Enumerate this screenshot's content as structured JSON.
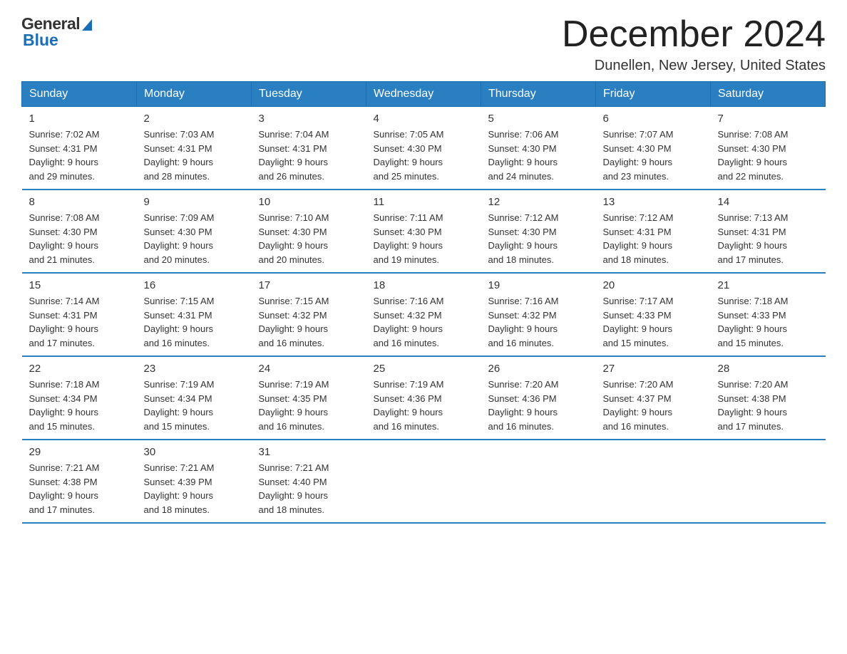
{
  "logo": {
    "general": "General",
    "blue": "Blue"
  },
  "title": "December 2024",
  "location": "Dunellen, New Jersey, United States",
  "days_of_week": [
    "Sunday",
    "Monday",
    "Tuesday",
    "Wednesday",
    "Thursday",
    "Friday",
    "Saturday"
  ],
  "weeks": [
    [
      {
        "day": "1",
        "sunrise": "7:02 AM",
        "sunset": "4:31 PM",
        "daylight": "9 hours and 29 minutes."
      },
      {
        "day": "2",
        "sunrise": "7:03 AM",
        "sunset": "4:31 PM",
        "daylight": "9 hours and 28 minutes."
      },
      {
        "day": "3",
        "sunrise": "7:04 AM",
        "sunset": "4:31 PM",
        "daylight": "9 hours and 26 minutes."
      },
      {
        "day": "4",
        "sunrise": "7:05 AM",
        "sunset": "4:30 PM",
        "daylight": "9 hours and 25 minutes."
      },
      {
        "day": "5",
        "sunrise": "7:06 AM",
        "sunset": "4:30 PM",
        "daylight": "9 hours and 24 minutes."
      },
      {
        "day": "6",
        "sunrise": "7:07 AM",
        "sunset": "4:30 PM",
        "daylight": "9 hours and 23 minutes."
      },
      {
        "day": "7",
        "sunrise": "7:08 AM",
        "sunset": "4:30 PM",
        "daylight": "9 hours and 22 minutes."
      }
    ],
    [
      {
        "day": "8",
        "sunrise": "7:08 AM",
        "sunset": "4:30 PM",
        "daylight": "9 hours and 21 minutes."
      },
      {
        "day": "9",
        "sunrise": "7:09 AM",
        "sunset": "4:30 PM",
        "daylight": "9 hours and 20 minutes."
      },
      {
        "day": "10",
        "sunrise": "7:10 AM",
        "sunset": "4:30 PM",
        "daylight": "9 hours and 20 minutes."
      },
      {
        "day": "11",
        "sunrise": "7:11 AM",
        "sunset": "4:30 PM",
        "daylight": "9 hours and 19 minutes."
      },
      {
        "day": "12",
        "sunrise": "7:12 AM",
        "sunset": "4:30 PM",
        "daylight": "9 hours and 18 minutes."
      },
      {
        "day": "13",
        "sunrise": "7:12 AM",
        "sunset": "4:31 PM",
        "daylight": "9 hours and 18 minutes."
      },
      {
        "day": "14",
        "sunrise": "7:13 AM",
        "sunset": "4:31 PM",
        "daylight": "9 hours and 17 minutes."
      }
    ],
    [
      {
        "day": "15",
        "sunrise": "7:14 AM",
        "sunset": "4:31 PM",
        "daylight": "9 hours and 17 minutes."
      },
      {
        "day": "16",
        "sunrise": "7:15 AM",
        "sunset": "4:31 PM",
        "daylight": "9 hours and 16 minutes."
      },
      {
        "day": "17",
        "sunrise": "7:15 AM",
        "sunset": "4:32 PM",
        "daylight": "9 hours and 16 minutes."
      },
      {
        "day": "18",
        "sunrise": "7:16 AM",
        "sunset": "4:32 PM",
        "daylight": "9 hours and 16 minutes."
      },
      {
        "day": "19",
        "sunrise": "7:16 AM",
        "sunset": "4:32 PM",
        "daylight": "9 hours and 16 minutes."
      },
      {
        "day": "20",
        "sunrise": "7:17 AM",
        "sunset": "4:33 PM",
        "daylight": "9 hours and 15 minutes."
      },
      {
        "day": "21",
        "sunrise": "7:18 AM",
        "sunset": "4:33 PM",
        "daylight": "9 hours and 15 minutes."
      }
    ],
    [
      {
        "day": "22",
        "sunrise": "7:18 AM",
        "sunset": "4:34 PM",
        "daylight": "9 hours and 15 minutes."
      },
      {
        "day": "23",
        "sunrise": "7:19 AM",
        "sunset": "4:34 PM",
        "daylight": "9 hours and 15 minutes."
      },
      {
        "day": "24",
        "sunrise": "7:19 AM",
        "sunset": "4:35 PM",
        "daylight": "9 hours and 16 minutes."
      },
      {
        "day": "25",
        "sunrise": "7:19 AM",
        "sunset": "4:36 PM",
        "daylight": "9 hours and 16 minutes."
      },
      {
        "day": "26",
        "sunrise": "7:20 AM",
        "sunset": "4:36 PM",
        "daylight": "9 hours and 16 minutes."
      },
      {
        "day": "27",
        "sunrise": "7:20 AM",
        "sunset": "4:37 PM",
        "daylight": "9 hours and 16 minutes."
      },
      {
        "day": "28",
        "sunrise": "7:20 AM",
        "sunset": "4:38 PM",
        "daylight": "9 hours and 17 minutes."
      }
    ],
    [
      {
        "day": "29",
        "sunrise": "7:21 AM",
        "sunset": "4:38 PM",
        "daylight": "9 hours and 17 minutes."
      },
      {
        "day": "30",
        "sunrise": "7:21 AM",
        "sunset": "4:39 PM",
        "daylight": "9 hours and 18 minutes."
      },
      {
        "day": "31",
        "sunrise": "7:21 AM",
        "sunset": "4:40 PM",
        "daylight": "9 hours and 18 minutes."
      },
      null,
      null,
      null,
      null
    ]
  ],
  "cell_labels": {
    "sunrise": "Sunrise:",
    "sunset": "Sunset:",
    "daylight": "Daylight:"
  }
}
